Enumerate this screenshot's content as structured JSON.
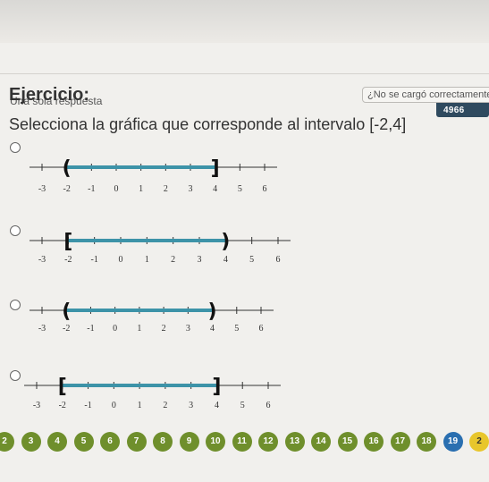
{
  "header": {
    "question_type": "Una sola respuesta",
    "lms_code": "LMS: 4966"
  },
  "title": "Ejercicio:",
  "not_loaded": "¿No se cargó correctamente?",
  "question": "Selecciona la gráfica que corresponde al intervalo [-2,4]",
  "options": [
    {
      "labels": [
        "-3",
        "-2",
        "-1",
        "0",
        "1",
        "2",
        "3",
        "4",
        "5",
        "6"
      ],
      "left_bracket": "(",
      "right_bracket": "]",
      "start": -2,
      "end": 4
    },
    {
      "labels": [
        "-3",
        "-2",
        "-1",
        "0",
        "1",
        "2",
        "3",
        "4",
        "5",
        "6"
      ],
      "left_bracket": "[",
      "right_bracket": ")",
      "start": -2,
      "end": 4
    },
    {
      "labels": [
        "-3",
        "-2",
        "-1",
        "0",
        "1",
        "2",
        "3",
        "4",
        "5",
        "6"
      ],
      "left_bracket": "(",
      "right_bracket": ")",
      "start": -2,
      "end": 4
    },
    {
      "labels": [
        "-3",
        "-2",
        "-1",
        "0",
        "1",
        "2",
        "3",
        "4",
        "5",
        "6"
      ],
      "left_bracket": "[",
      "right_bracket": "]",
      "start": -2,
      "end": 4
    }
  ],
  "pager": [
    "2",
    "3",
    "4",
    "5",
    "6",
    "7",
    "8",
    "9",
    "10",
    "11",
    "12",
    "13",
    "14",
    "15",
    "16",
    "17",
    "18",
    "19",
    "2"
  ],
  "colors": {
    "interval": "#3d93a8",
    "page": "#6f8f2c",
    "page_active": "#2a6fb0",
    "lms_badge": "#2f4a5f"
  }
}
